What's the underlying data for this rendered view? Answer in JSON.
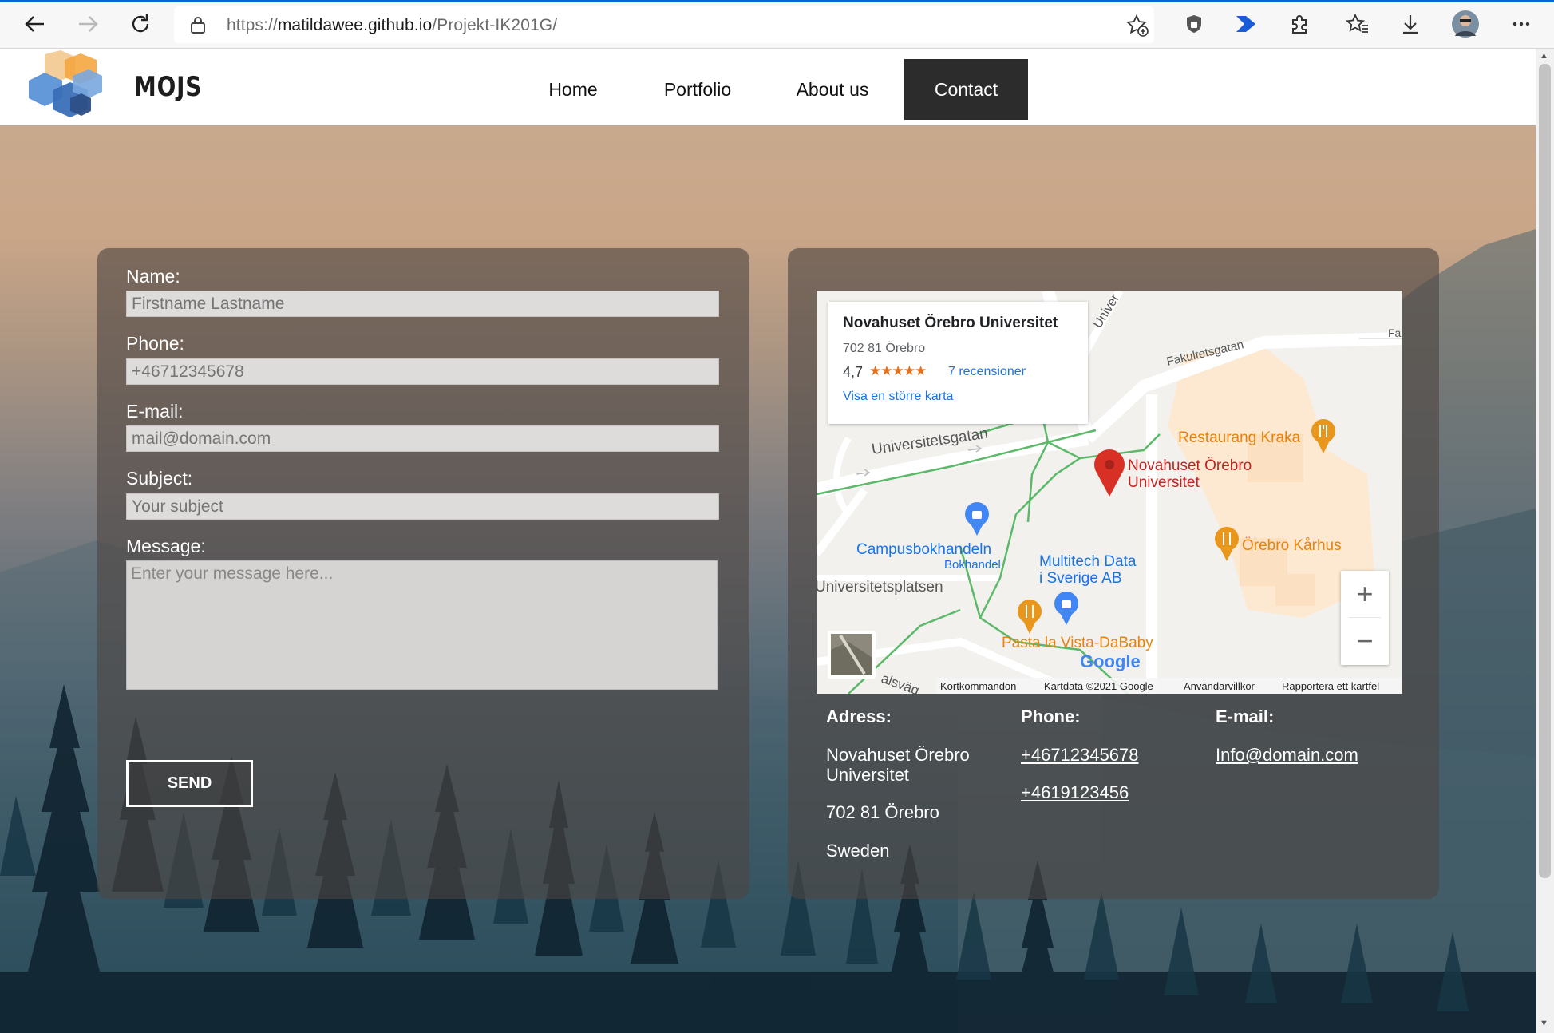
{
  "browser": {
    "url_prefix": "https://",
    "url_host": "matildawee.github.io",
    "url_path": "/Projekt-IK201G/",
    "icons": [
      "back-icon",
      "forward-icon",
      "reload-icon",
      "lock-icon",
      "add-favorite-icon",
      "shield-extension-icon",
      "arrow-extension-icon",
      "extensions-icon",
      "favorites-icon",
      "downloads-icon",
      "profile-avatar",
      "more-icon"
    ]
  },
  "site": {
    "logo_text": "MOJS",
    "nav": [
      {
        "label": "Home",
        "active": false
      },
      {
        "label": "Portfolio",
        "active": false
      },
      {
        "label": "About us",
        "active": false
      },
      {
        "label": "Contact",
        "active": true
      }
    ]
  },
  "form": {
    "name_label": "Name:",
    "name_placeholder": "Firstname Lastname",
    "phone_label": "Phone:",
    "phone_placeholder": "+46712345678",
    "email_label": "E-mail:",
    "email_placeholder": "mail@domain.com",
    "subject_label": "Subject:",
    "subject_placeholder": "Your subject",
    "message_label": "Message:",
    "message_placeholder": "Enter your message here...",
    "send_label": "SEND"
  },
  "map": {
    "card_title": "Novahuset Örebro Universitet",
    "card_address": "702 81 Örebro",
    "rating": "4,7",
    "stars": "★★★★★",
    "reviews": "7 recensioner",
    "larger_map": "Visa en större karta",
    "labels": {
      "fakultetsgatan": "Fakultetsgatan",
      "universitetsgatan": "Universitetsgatan",
      "univer": "Univer",
      "fa": "Fa",
      "restaurang": "Restaurang Kraka",
      "novahuset_1": "Novahuset Örebro",
      "novahuset_2": "Universitet",
      "campus_1": "Campusbokhandeln",
      "campus_2": "Bokhandel",
      "karhus": "Örebro Kårhus",
      "multitech_1": "Multitech Data",
      "multitech_2": "i Sverige AB",
      "universitetsplatsen": "Universitetsplatsen",
      "pasta": "Pasta la Vista-DaBaby",
      "alsvag": "alsväg",
      "google": "Google"
    },
    "footer": {
      "shortcuts": "Kortkommandon",
      "mapdata": "Kartdata ©2021 Google",
      "terms": "Användarvillkor",
      "report": "Rapportera ett kartfel"
    },
    "zoom_in": "+",
    "zoom_out": "−"
  },
  "contact": {
    "address_heading": "Adress:",
    "address_line1": "Novahuset Örebro",
    "address_line2": "Universitet",
    "address_line3": "702 81 Örebro",
    "address_line4": "Sweden",
    "phone_heading": "Phone:",
    "phone_1": "+46712345678",
    "phone_2": "+4619123456",
    "email_heading": "E-mail:",
    "email_1": "Info@domain.com"
  },
  "colors": {
    "accent_blue": "#0a64d8",
    "nav_active": "#2c2c2c",
    "map_pin_red": "#d93025",
    "map_poi_orange": "#e8961c",
    "map_poi_blue": "#4285f4",
    "map_road_green": "#5cb96a"
  }
}
